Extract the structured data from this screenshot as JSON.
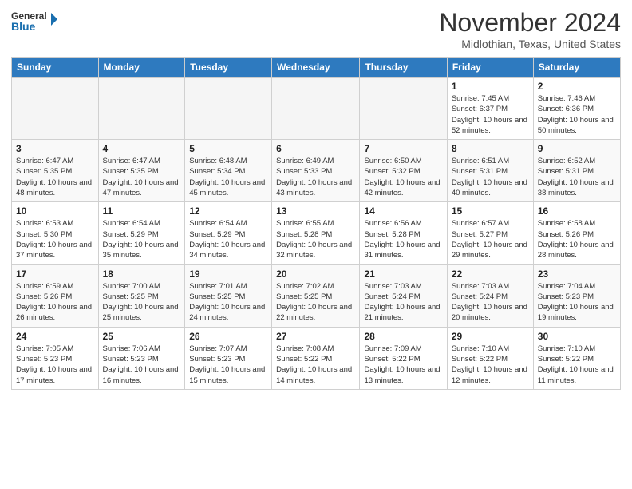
{
  "header": {
    "logo_line1": "General",
    "logo_line2": "Blue",
    "month": "November 2024",
    "location": "Midlothian, Texas, United States"
  },
  "weekdays": [
    "Sunday",
    "Monday",
    "Tuesday",
    "Wednesday",
    "Thursday",
    "Friday",
    "Saturday"
  ],
  "weeks": [
    [
      {
        "day": "",
        "empty": true
      },
      {
        "day": "",
        "empty": true
      },
      {
        "day": "",
        "empty": true
      },
      {
        "day": "",
        "empty": true
      },
      {
        "day": "",
        "empty": true
      },
      {
        "day": "1",
        "sunrise": "7:45 AM",
        "sunset": "6:37 PM",
        "daylight": "10 hours and 52 minutes."
      },
      {
        "day": "2",
        "sunrise": "7:46 AM",
        "sunset": "6:36 PM",
        "daylight": "10 hours and 50 minutes."
      }
    ],
    [
      {
        "day": "3",
        "sunrise": "6:47 AM",
        "sunset": "5:35 PM",
        "daylight": "10 hours and 48 minutes."
      },
      {
        "day": "4",
        "sunrise": "6:47 AM",
        "sunset": "5:35 PM",
        "daylight": "10 hours and 47 minutes."
      },
      {
        "day": "5",
        "sunrise": "6:48 AM",
        "sunset": "5:34 PM",
        "daylight": "10 hours and 45 minutes."
      },
      {
        "day": "6",
        "sunrise": "6:49 AM",
        "sunset": "5:33 PM",
        "daylight": "10 hours and 43 minutes."
      },
      {
        "day": "7",
        "sunrise": "6:50 AM",
        "sunset": "5:32 PM",
        "daylight": "10 hours and 42 minutes."
      },
      {
        "day": "8",
        "sunrise": "6:51 AM",
        "sunset": "5:31 PM",
        "daylight": "10 hours and 40 minutes."
      },
      {
        "day": "9",
        "sunrise": "6:52 AM",
        "sunset": "5:31 PM",
        "daylight": "10 hours and 38 minutes."
      }
    ],
    [
      {
        "day": "10",
        "sunrise": "6:53 AM",
        "sunset": "5:30 PM",
        "daylight": "10 hours and 37 minutes."
      },
      {
        "day": "11",
        "sunrise": "6:54 AM",
        "sunset": "5:29 PM",
        "daylight": "10 hours and 35 minutes."
      },
      {
        "day": "12",
        "sunrise": "6:54 AM",
        "sunset": "5:29 PM",
        "daylight": "10 hours and 34 minutes."
      },
      {
        "day": "13",
        "sunrise": "6:55 AM",
        "sunset": "5:28 PM",
        "daylight": "10 hours and 32 minutes."
      },
      {
        "day": "14",
        "sunrise": "6:56 AM",
        "sunset": "5:28 PM",
        "daylight": "10 hours and 31 minutes."
      },
      {
        "day": "15",
        "sunrise": "6:57 AM",
        "sunset": "5:27 PM",
        "daylight": "10 hours and 29 minutes."
      },
      {
        "day": "16",
        "sunrise": "6:58 AM",
        "sunset": "5:26 PM",
        "daylight": "10 hours and 28 minutes."
      }
    ],
    [
      {
        "day": "17",
        "sunrise": "6:59 AM",
        "sunset": "5:26 PM",
        "daylight": "10 hours and 26 minutes."
      },
      {
        "day": "18",
        "sunrise": "7:00 AM",
        "sunset": "5:25 PM",
        "daylight": "10 hours and 25 minutes."
      },
      {
        "day": "19",
        "sunrise": "7:01 AM",
        "sunset": "5:25 PM",
        "daylight": "10 hours and 24 minutes."
      },
      {
        "day": "20",
        "sunrise": "7:02 AM",
        "sunset": "5:25 PM",
        "daylight": "10 hours and 22 minutes."
      },
      {
        "day": "21",
        "sunrise": "7:03 AM",
        "sunset": "5:24 PM",
        "daylight": "10 hours and 21 minutes."
      },
      {
        "day": "22",
        "sunrise": "7:03 AM",
        "sunset": "5:24 PM",
        "daylight": "10 hours and 20 minutes."
      },
      {
        "day": "23",
        "sunrise": "7:04 AM",
        "sunset": "5:23 PM",
        "daylight": "10 hours and 19 minutes."
      }
    ],
    [
      {
        "day": "24",
        "sunrise": "7:05 AM",
        "sunset": "5:23 PM",
        "daylight": "10 hours and 17 minutes."
      },
      {
        "day": "25",
        "sunrise": "7:06 AM",
        "sunset": "5:23 PM",
        "daylight": "10 hours and 16 minutes."
      },
      {
        "day": "26",
        "sunrise": "7:07 AM",
        "sunset": "5:23 PM",
        "daylight": "10 hours and 15 minutes."
      },
      {
        "day": "27",
        "sunrise": "7:08 AM",
        "sunset": "5:22 PM",
        "daylight": "10 hours and 14 minutes."
      },
      {
        "day": "28",
        "sunrise": "7:09 AM",
        "sunset": "5:22 PM",
        "daylight": "10 hours and 13 minutes."
      },
      {
        "day": "29",
        "sunrise": "7:10 AM",
        "sunset": "5:22 PM",
        "daylight": "10 hours and 12 minutes."
      },
      {
        "day": "30",
        "sunrise": "7:10 AM",
        "sunset": "5:22 PM",
        "daylight": "10 hours and 11 minutes."
      }
    ]
  ]
}
